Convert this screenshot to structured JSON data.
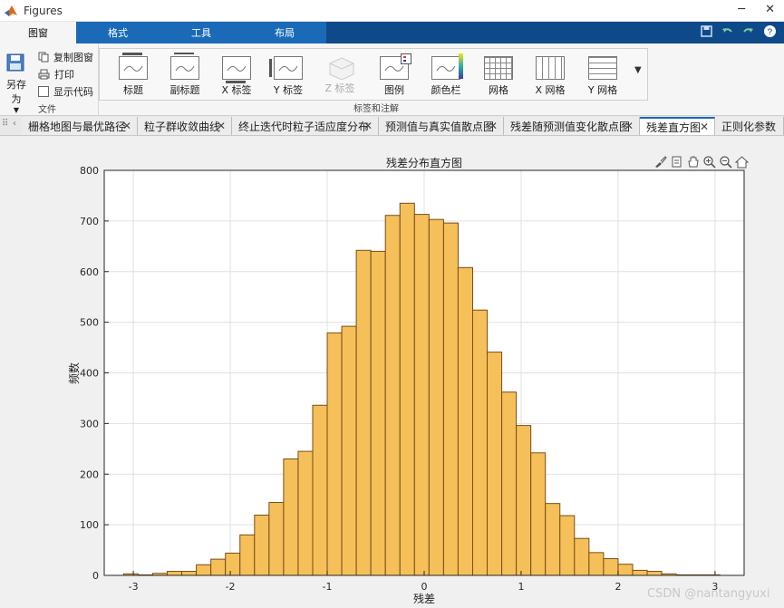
{
  "window": {
    "title": "Figures"
  },
  "ribbon": {
    "tabs": [
      {
        "label": "图窗"
      },
      {
        "label": "格式"
      },
      {
        "label": "工具"
      },
      {
        "label": "布局"
      }
    ],
    "file_group": {
      "save_as": "另存为",
      "copy_figure": "复制图窗",
      "print": "打印",
      "show_code": "显示代码",
      "label": "文件"
    },
    "annot_group": {
      "label": "标签和注解",
      "buttons": [
        {
          "label": "标题"
        },
        {
          "label": "副标题"
        },
        {
          "label": "X 标签"
        },
        {
          "label": "Y 标签"
        },
        {
          "label": "Z 标签"
        },
        {
          "label": "图例"
        },
        {
          "label": "颜色栏"
        },
        {
          "label": "网格"
        },
        {
          "label": "X 网格"
        },
        {
          "label": "Y 网格"
        }
      ]
    }
  },
  "doc_tabs": [
    {
      "label": "栅格地图与最优路径"
    },
    {
      "label": "粒子群收敛曲线"
    },
    {
      "label": "终止迭代时粒子适应度分布"
    },
    {
      "label": "预测值与真实值散点图"
    },
    {
      "label": "残差随预测值变化散点图"
    },
    {
      "label": "残差直方图"
    },
    {
      "label": "正则化参数"
    }
  ],
  "watermark": "CSDN @nantangyuxi",
  "colors": {
    "bar_fill": "#f5c05a",
    "bar_edge": "#7a4c17",
    "tab_active_blue": "#1e63b5"
  },
  "chart_data": {
    "type": "bar",
    "title": "残差分布直方图",
    "xlabel": "残差",
    "ylabel": "频数",
    "xlim": [
      -3.3,
      3.3
    ],
    "ylim": [
      0,
      800
    ],
    "xticks": [
      -3,
      -2,
      -1,
      0,
      1,
      2,
      3
    ],
    "yticks": [
      0,
      100,
      200,
      300,
      400,
      500,
      600,
      700,
      800
    ],
    "grid": true,
    "bin_edges": [
      -3.1,
      -2.95,
      -2.8,
      -2.65,
      -2.5,
      -2.35,
      -2.2,
      -2.05,
      -1.9,
      -1.75,
      -1.6,
      -1.45,
      -1.3,
      -1.15,
      -1.0,
      -0.85,
      -0.7,
      -0.55,
      -0.4,
      -0.25,
      -0.1,
      0.05,
      0.2,
      0.35,
      0.5,
      0.65,
      0.8,
      0.95,
      1.1,
      1.25,
      1.4,
      1.55,
      1.7,
      1.85,
      2.0,
      2.15,
      2.3,
      2.45,
      2.6,
      2.75,
      2.9,
      3.05
    ],
    "values": [
      3,
      1,
      4,
      8,
      8,
      21,
      32,
      44,
      80,
      119,
      144,
      230,
      245,
      336,
      479,
      492,
      642,
      640,
      711,
      735,
      713,
      703,
      696,
      608,
      524,
      441,
      362,
      296,
      242,
      142,
      118,
      73,
      45,
      33,
      22,
      10,
      8,
      3,
      1,
      1,
      1
    ]
  }
}
